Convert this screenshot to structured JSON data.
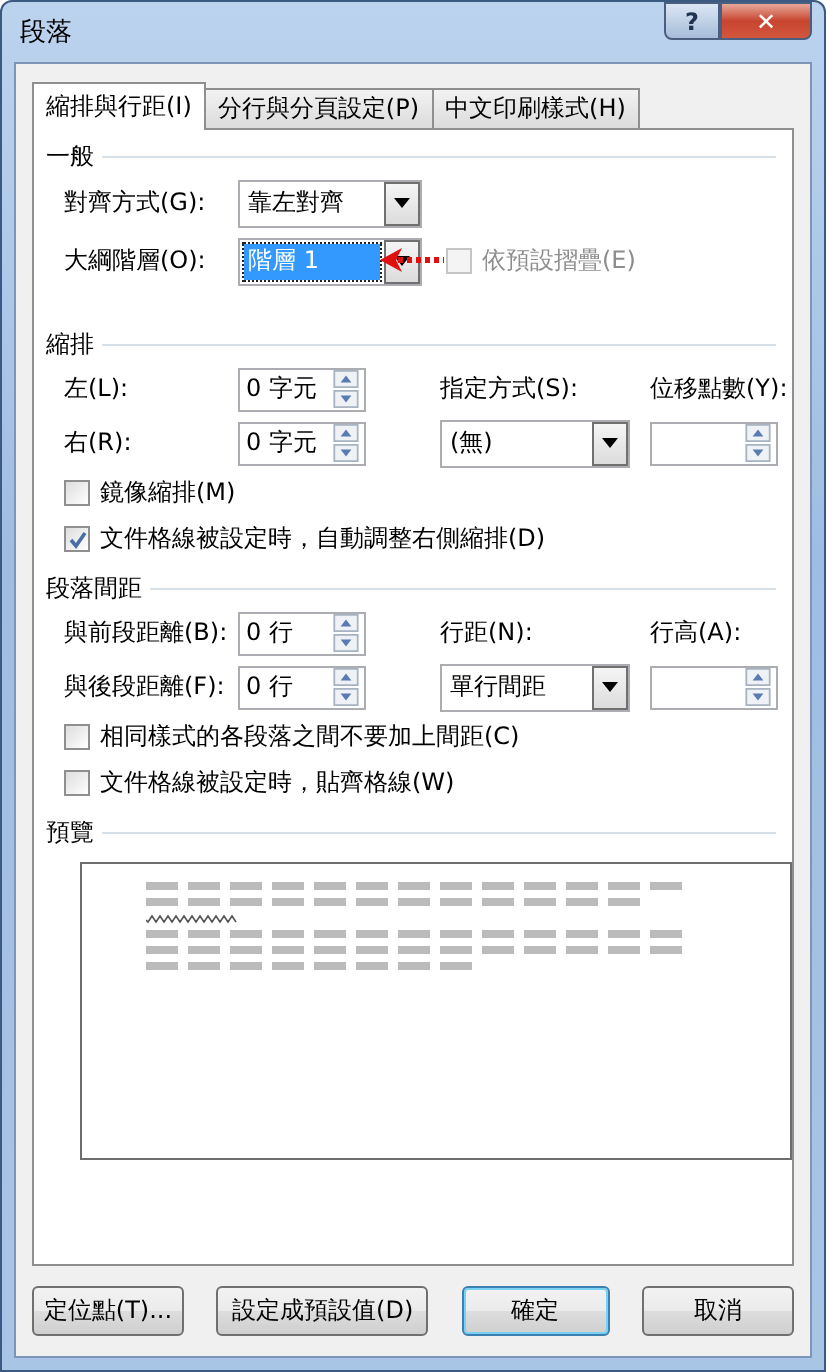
{
  "window": {
    "title": "段落",
    "help_button": "?",
    "close_button": "✕"
  },
  "tabs": [
    {
      "label": "縮排與行距(I)",
      "selected": true
    },
    {
      "label": "分行與分頁設定(P)",
      "selected": false
    },
    {
      "label": "中文印刷樣式(H)",
      "selected": false
    }
  ],
  "general": {
    "heading": "一般",
    "alignment": {
      "label": "對齊方式(G):",
      "value": "靠左對齊"
    },
    "outline_level": {
      "label": "大綱階層(O):",
      "value": "階層 1",
      "selected": true
    },
    "collapse": {
      "label": "依預設摺疊(E)",
      "checked": false,
      "disabled": true
    },
    "annotation": {
      "kind": "arrow"
    }
  },
  "indentation": {
    "heading": "縮排",
    "left": {
      "label": "左(L):",
      "value": "0 字元"
    },
    "right": {
      "label": "右(R):",
      "value": "0 字元"
    },
    "special": {
      "label": "指定方式(S):",
      "value": "(無)"
    },
    "by": {
      "label": "位移點數(Y):"
    },
    "checkboxes": [
      {
        "label": "鏡像縮排(M)",
        "checked": false
      },
      {
        "label": "文件格線被設定時，自動調整右側縮排(D)",
        "checked": true
      }
    ]
  },
  "spacing": {
    "heading": "段落間距",
    "before": {
      "label": "與前段距離(B):",
      "value": "0 行"
    },
    "after": {
      "label": "與後段距離(F):",
      "value": "0 行"
    },
    "line_spacing": {
      "label": "行距(N):",
      "value": "單行間距"
    },
    "at": {
      "label": "行高(A):"
    },
    "checkboxes": [
      {
        "label": "相同樣式的各段落之間不要加上間距(C)",
        "checked": false
      },
      {
        "label": "文件格線被設定時，貼齊格線(W)",
        "checked": false
      }
    ]
  },
  "preview": {
    "heading": "預覽"
  },
  "buttons": [
    {
      "label": "定位點(T)...",
      "default": false
    },
    {
      "label": "設定成預設值(D)",
      "default": false
    },
    {
      "label": "確定",
      "default": true
    },
    {
      "label": "取消",
      "default": false
    }
  ]
}
